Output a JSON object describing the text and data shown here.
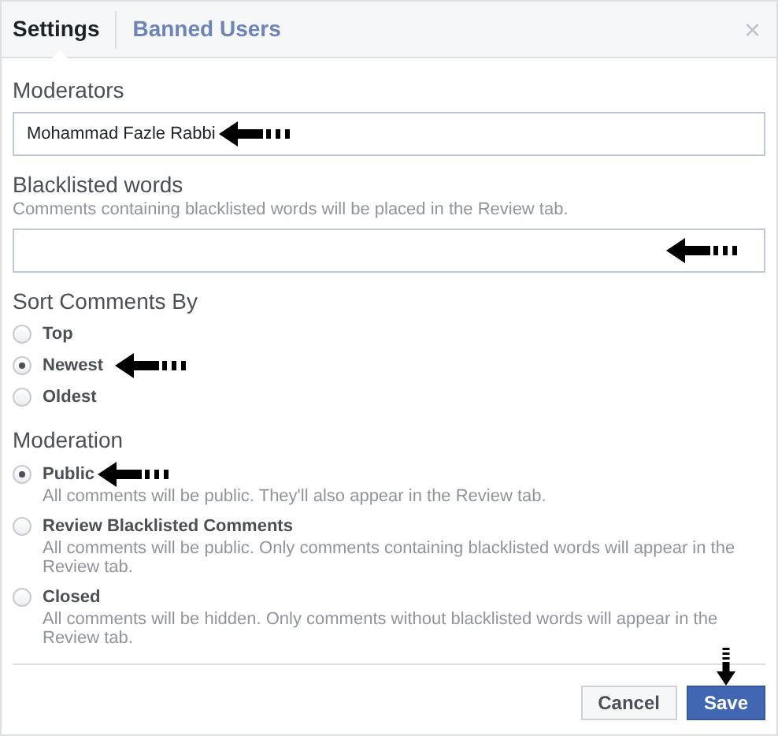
{
  "tabs": [
    {
      "label": "Settings",
      "selected": true
    },
    {
      "label": "Banned Users",
      "selected": false
    }
  ],
  "close": "×",
  "moderators": {
    "label": "Moderators",
    "value": "Mohammad Fazle Rabbi",
    "arrow": true
  },
  "blacklist": {
    "label": "Blacklisted words",
    "help": "Comments containing blacklisted words will be placed in the Review tab.",
    "arrow": true
  },
  "sort": {
    "label": "Sort Comments By",
    "options": [
      {
        "label": "Top",
        "selected": false,
        "arrow": false
      },
      {
        "label": "Newest",
        "selected": true,
        "arrow": true
      },
      {
        "label": "Oldest",
        "selected": false,
        "arrow": false
      }
    ]
  },
  "moderation": {
    "label": "Moderation",
    "options": [
      {
        "label": "Public",
        "description": "All comments will be public. They'll also appear in the Review tab.",
        "selected": true,
        "arrow": true
      },
      {
        "label": "Review Blacklisted Comments",
        "description": "All comments will be public. Only comments containing blacklisted words will appear in the Review tab.",
        "selected": false,
        "arrow": false
      },
      {
        "label": "Closed",
        "description": "All comments will be hidden. Only comments without blacklisted words will appear in the Review tab.",
        "selected": false,
        "arrow": false
      }
    ]
  },
  "buttons": [
    {
      "label": "Cancel",
      "kind": "secondary",
      "arrow": false
    },
    {
      "label": "Save",
      "kind": "primary",
      "arrow": true
    }
  ]
}
